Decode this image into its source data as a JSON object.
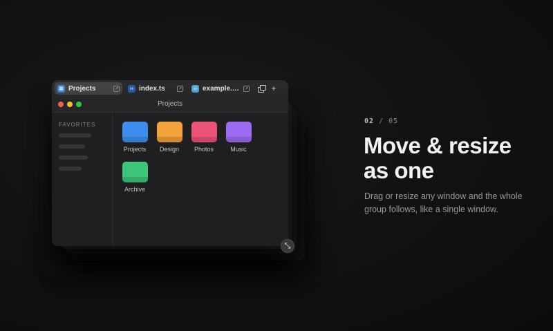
{
  "tabs": [
    {
      "label": "Projects",
      "icon": "folder-icon",
      "active": true
    },
    {
      "label": "index.ts",
      "icon": "typescript-file-icon",
      "active": false
    },
    {
      "label": "example.c...",
      "icon": "web-page-icon",
      "active": false
    }
  ],
  "tab_bar": {
    "add_label": "+"
  },
  "window": {
    "title": "Projects",
    "sidebar_heading": "FAVORITES",
    "folders": [
      {
        "label": "Projects",
        "color": "#3d8fef"
      },
      {
        "label": "Design",
        "color": "#f2a33a"
      },
      {
        "label": "Photos",
        "color": "#ec5477"
      },
      {
        "label": "Music",
        "color": "#9d6cf3"
      },
      {
        "label": "Archive",
        "color": "#3ec57c"
      }
    ]
  },
  "slide": {
    "step_current": "02",
    "step_separator": " / ",
    "step_total": "05",
    "headline_line1": "Move & resize",
    "headline_line2": "as one",
    "description": "Drag or resize any window and the whole group follows, like a single window."
  },
  "colors": {
    "traffic_red": "#f25f56",
    "traffic_yellow": "#f5bc2f",
    "traffic_green": "#2ec741"
  }
}
